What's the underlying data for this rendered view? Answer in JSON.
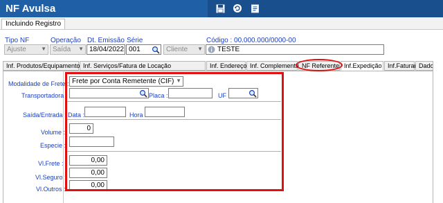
{
  "app": {
    "title": "NF Avulsa"
  },
  "toolbar": {
    "icons": [
      "save-icon",
      "refresh-icon",
      "form-icon"
    ]
  },
  "status": {
    "label": "Incluindo Registro"
  },
  "header": {
    "tipo_nf": {
      "label": "Tipo NF",
      "value": "Ajuste"
    },
    "operacao": {
      "label": "Operação",
      "value": "Saída"
    },
    "dt_emissao": {
      "label": "Dt. Emissão",
      "value": "18/04/2022"
    },
    "serie": {
      "label": "Série",
      "value": "001"
    },
    "destinatario": {
      "value": "Cliente"
    },
    "codigo": {
      "label": "Código : 00.000.000/0000-00",
      "value": "TESTE"
    }
  },
  "tabs": [
    {
      "label": "Inf. Produtos/Equipamentos"
    },
    {
      "label": "Inf. Serviços/Fatura de Locação"
    },
    {
      "label": "Inf. Endereços"
    },
    {
      "label": "Inf. Complementar"
    },
    {
      "label": "NF Referente"
    },
    {
      "label": "Inf.Expedição",
      "active": true
    },
    {
      "label": "Inf.Faturamento"
    },
    {
      "label": "Dados Adicionais"
    }
  ],
  "expedicao": {
    "modalidade_label": "Modalidade de Frete :",
    "modalidade_value": "Frete por Conta Remetente (CIF)",
    "transportadora_label": "Transportadora :",
    "transportadora_value": "",
    "placa_label": "Placa :",
    "placa_value": "",
    "uf_label": "UF :",
    "uf_value": "",
    "saida_entrada_label": "Saída/Entrada :",
    "data_label": "Data :",
    "data_value": "",
    "hora_label": "Hora :",
    "hora_value": "",
    "volume_label": "Volume :",
    "volume_value": "0",
    "especie_label": "Especie :",
    "especie_value": "",
    "vl_frete_label": "Vl.Frete :",
    "vl_frete_value": "0,00",
    "vl_seguro_label": "Vl.Seguro :",
    "vl_seguro_value": "0,00",
    "vl_outros_label": "Vl.Outros :",
    "vl_outros_value": "0,00"
  },
  "colors": {
    "titlebar": "#1f5fa6",
    "label_blue": "#1b3fbf",
    "highlight_red": "#e01010"
  }
}
